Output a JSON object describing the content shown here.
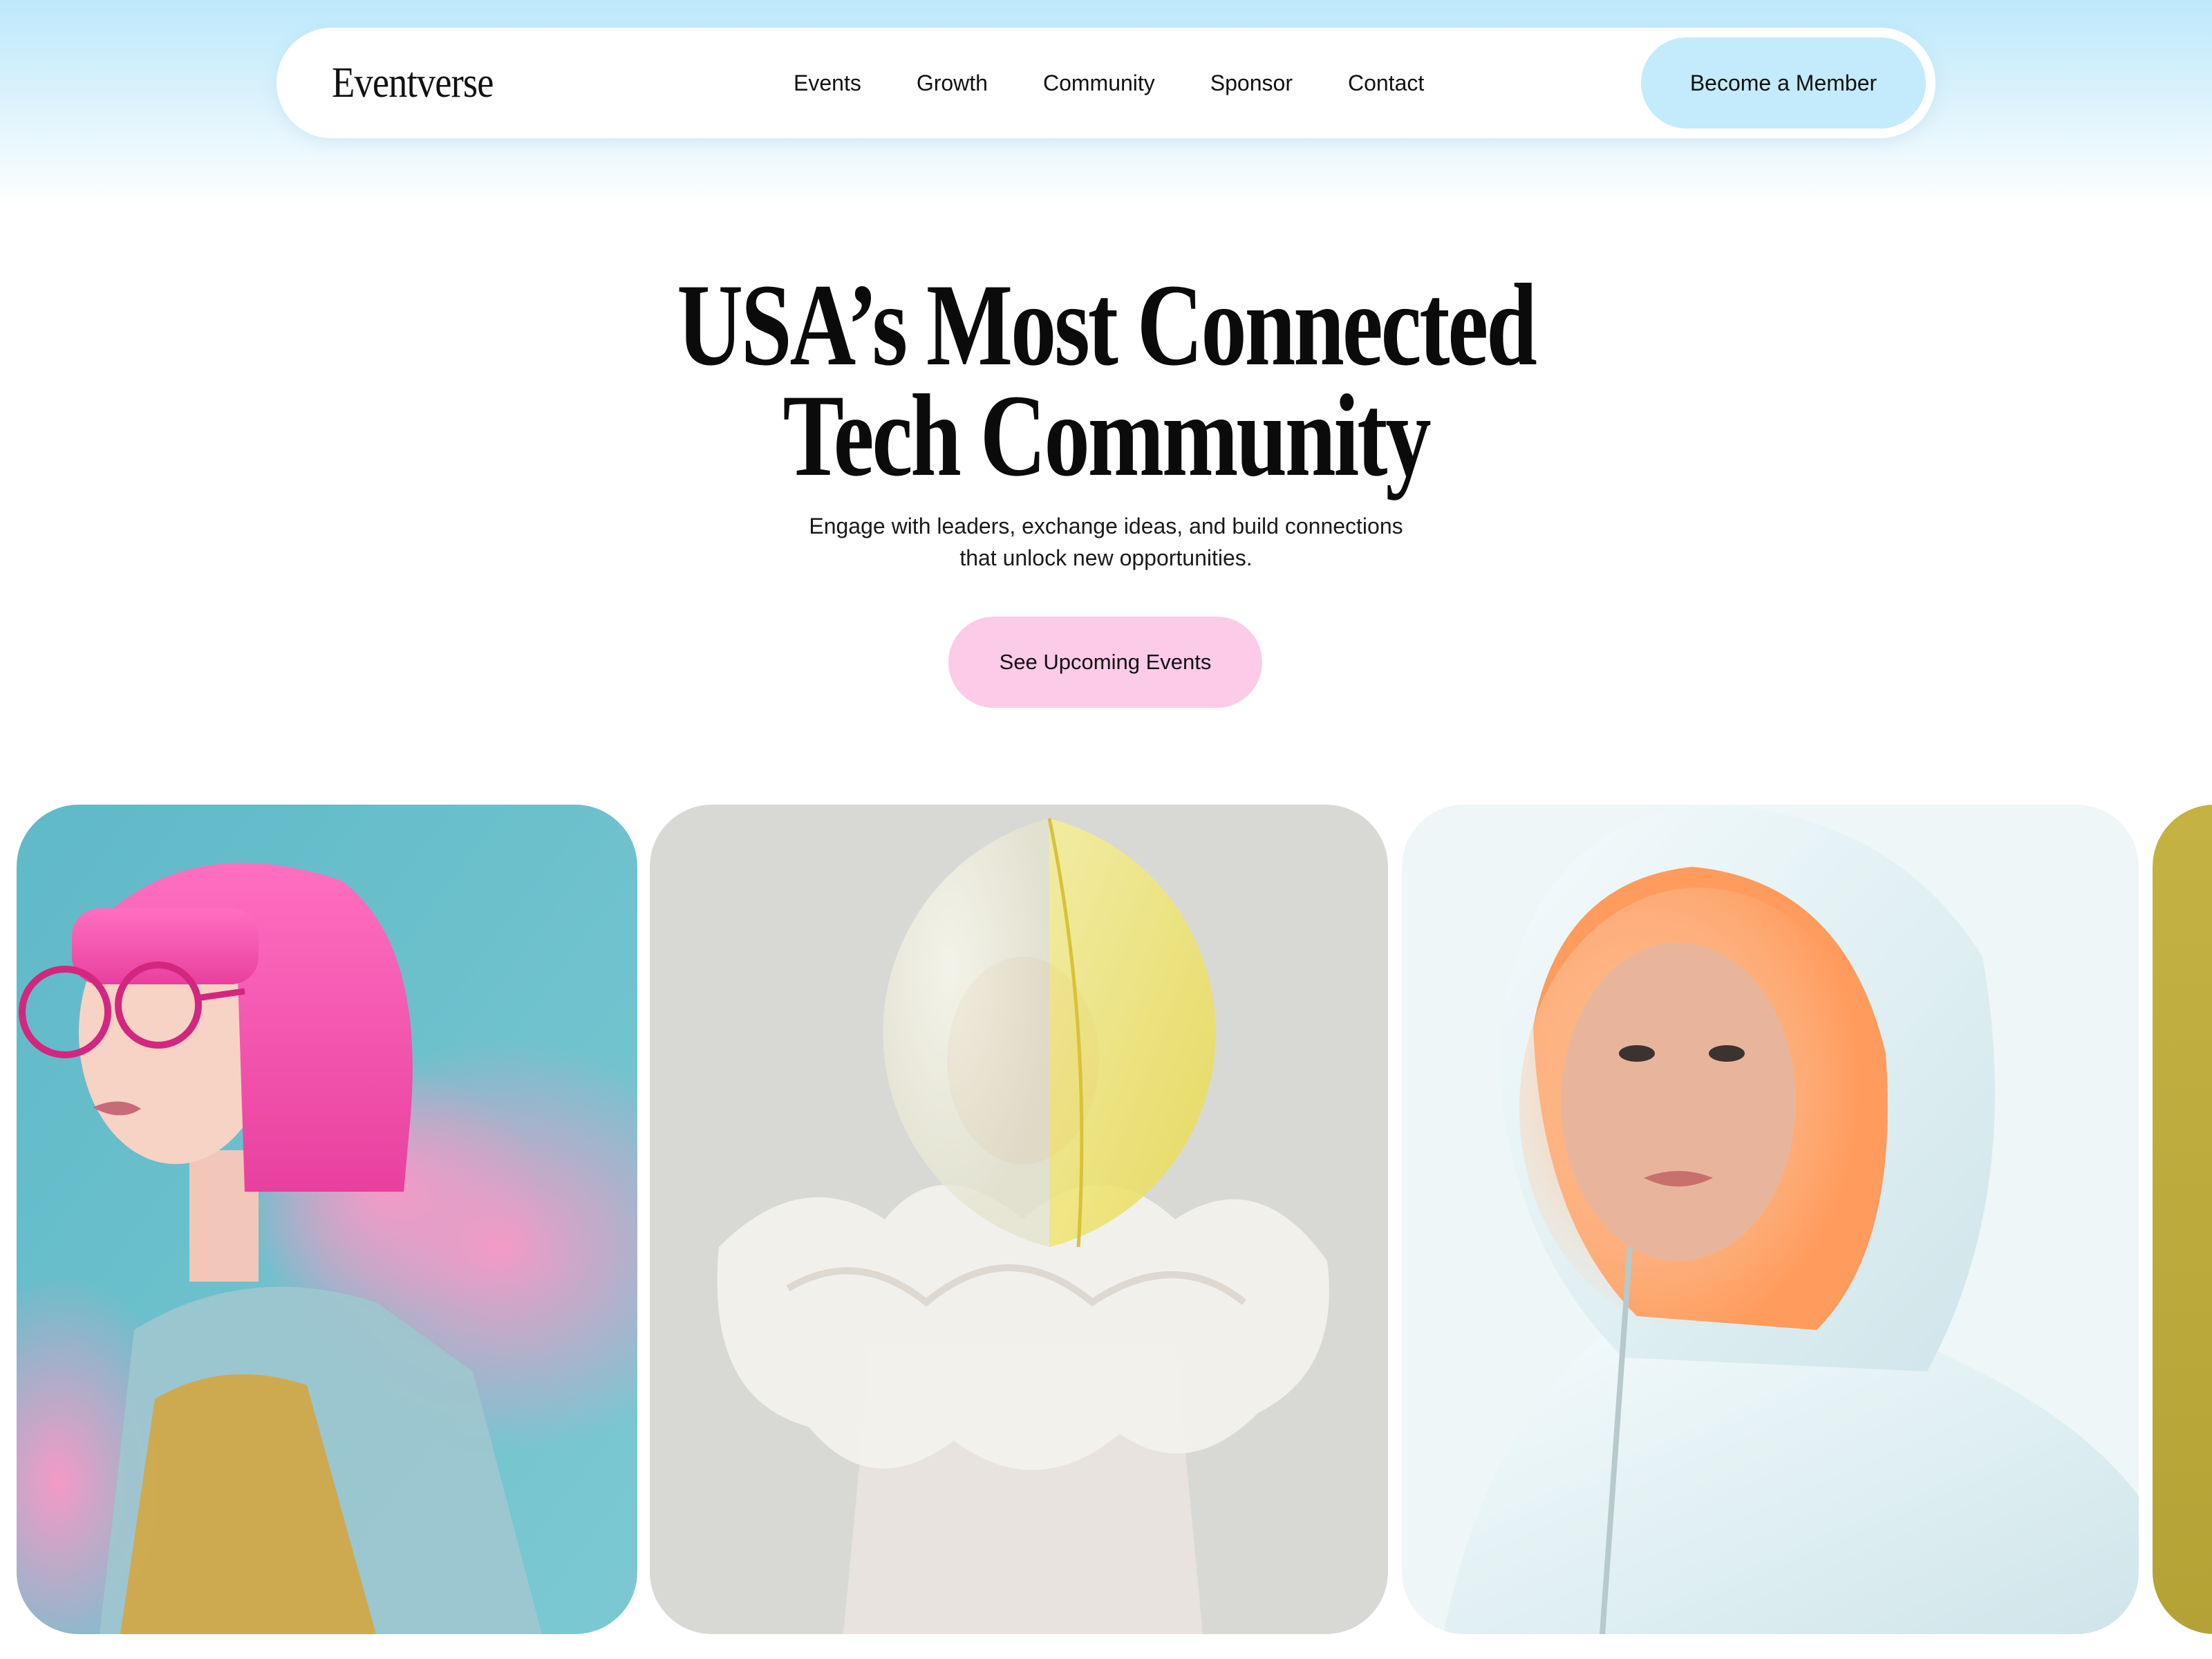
{
  "brand": {
    "name": "Eventverse"
  },
  "nav": {
    "links": [
      "Events",
      "Growth",
      "Community",
      "Sponsor",
      "Contact"
    ],
    "cta_label": "Become a Member"
  },
  "hero": {
    "title_line1": "USA’s Most Connected",
    "title_line2": "Tech Community",
    "subtitle_line1": "Engage with leaders, exchange ideas, and build connections",
    "subtitle_line2": "that unlock new opportunities.",
    "cta_label": "See Upcoming Events"
  },
  "colors": {
    "header_gradient": "#bde9fb",
    "member_button": "#c3ebfb",
    "cta_button": "#fccbe8",
    "text": "#0b0b0b"
  }
}
